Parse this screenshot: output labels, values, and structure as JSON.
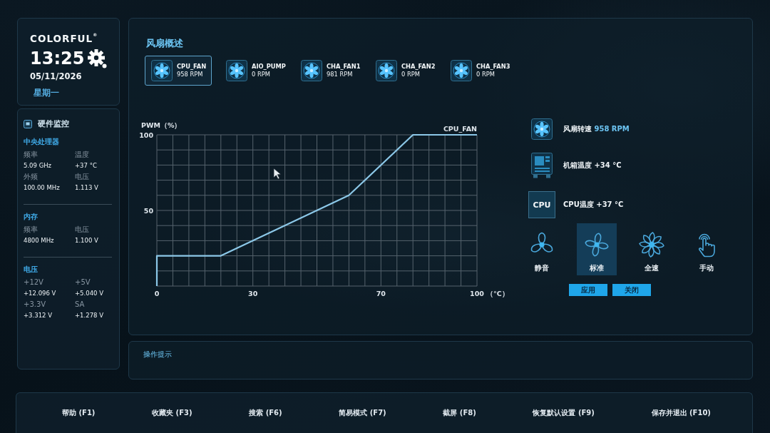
{
  "sidebar": {
    "brand": "COLORFUL$^{®}$",
    "time": "13:25",
    "date": "05/11/2026",
    "weekday": "星期一",
    "monitor": {
      "title": "硬件监控",
      "groups": [
        {
          "title": "中央处理器",
          "items": [
            {
              "label": "频率",
              "value": "5.09 GHz"
            },
            {
              "label": "温度",
              "value": "+37 °C"
            },
            {
              "label": "外频",
              "value": "100.00 MHz"
            },
            {
              "label": "电压",
              "value": "1.113 V"
            }
          ]
        },
        {
          "title": "内存",
          "items": [
            {
              "label": "频率",
              "value": "4800 MHz"
            },
            {
              "label": "电压",
              "value": "1.100 V"
            }
          ]
        },
        {
          "title": "电压",
          "items": [
            {
              "label": "+12V",
              "value": "+12.096 V"
            },
            {
              "label": "+5V",
              "value": "+5.040 V"
            },
            {
              "label": "+3.3V",
              "value": "+3.312 V"
            },
            {
              "label": "SA",
              "value": "+1.278 V"
            }
          ]
        }
      ]
    }
  },
  "fan_overview": {
    "title": "风扇概述",
    "fans": [
      {
        "name": "CPU_FAN",
        "speed": "958 RPM",
        "selected": true
      },
      {
        "name": "AIO_PUMP",
        "speed": "0 RPM",
        "selected": false
      },
      {
        "name": "CHA_FAN1",
        "speed": "981 RPM",
        "selected": false
      },
      {
        "name": "CHA_FAN2",
        "speed": "0 RPM",
        "selected": false
      },
      {
        "name": "CHA_FAN3",
        "speed": "0 RPM",
        "selected": false
      }
    ],
    "chart_data": [
      {
        "type": "line",
        "ylabel": "PWM（%）",
        "xlabel": "（°C）",
        "x": [
          0,
          0,
          20,
          60,
          80,
          100
        ],
        "xlim": [
          0,
          100
        ],
        "ylim": [
          0,
          100
        ],
        "xticks": [
          0,
          30,
          70,
          100
        ],
        "yticks": [
          50,
          100
        ],
        "grid": true,
        "series": [
          {
            "name": "CPU_FAN",
            "color": "#8cc8e8",
            "values": [
              0,
              20,
              20,
              60,
              100,
              100
            ]
          }
        ]
      }
    ],
    "readings": [
      {
        "kind": "fan",
        "label": "风扇转速",
        "value": "958 RPM"
      },
      {
        "kind": "case",
        "label": "机箱温度",
        "value": "+34 °C"
      },
      {
        "kind": "cpu",
        "icon_text": "CPU",
        "label": "CPU温度",
        "value": "+37 °C"
      }
    ],
    "modes": [
      {
        "kind": "silent",
        "label": "静音",
        "selected": false
      },
      {
        "kind": "standard",
        "label": "标准",
        "selected": true
      },
      {
        "kind": "full",
        "label": "全速",
        "selected": false
      },
      {
        "kind": "manual",
        "label": "手动",
        "selected": false
      }
    ],
    "buttons": [
      "应用",
      "关闭"
    ]
  },
  "tips": {
    "title": "操作提示"
  },
  "function_bar": [
    "帮助 (F1)",
    "收藏夹 (F3)",
    "搜索 (F6)",
    "简易模式 (F7)",
    "截屏 (F8)",
    "恢复默认设置 (F9)",
    "保存并退出 (F10)"
  ]
}
